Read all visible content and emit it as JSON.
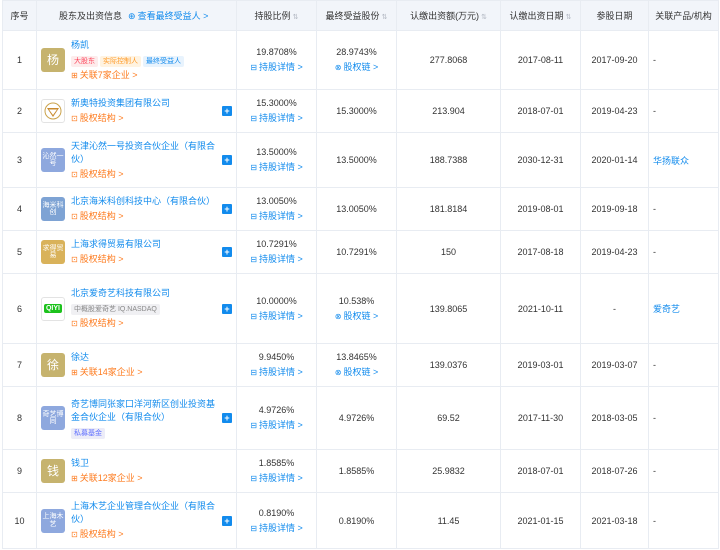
{
  "headers": {
    "seq": "序号",
    "holder": "股东及出资信息",
    "trace_link": "查看最终受益人",
    "trace_arrow": ">",
    "ratio": "持股比例",
    "final_ratio": "最终受益股份",
    "amount": "认缴出资额(万元)",
    "date": "认缴出资日期",
    "join_date": "参股日期",
    "product": "关联产品/机构"
  },
  "link_detail": "持股详情 >",
  "link_chain": "股权链 >",
  "link_structure": "股权结构 >",
  "rows": [
    {
      "seq": "1",
      "logo_text": "杨",
      "logo_color": "#c6b36e",
      "logo_size": "big",
      "name": "杨凯",
      "tags": [
        {
          "text": "大股东",
          "style": "red"
        },
        {
          "text": "实际控制人",
          "style": "orange"
        },
        {
          "text": "最终受益人",
          "style": "blue"
        }
      ],
      "sublink": "关联7家企业 >",
      "sublink_icon": "⊞",
      "plus": false,
      "ratio": "19.8708%",
      "final_ratio": "28.9743%",
      "final_link": true,
      "amount": "277.8068",
      "date": "2017-08-11",
      "join_date": "2017-09-20",
      "product": "-",
      "product_is_link": false
    },
    {
      "seq": "2",
      "logo_text": "",
      "logo_kind": "xinmeite",
      "logo_color": "#ffffff",
      "logo_size": "big",
      "name": "新奥特投资集团有限公司",
      "tags": [],
      "sublink": "股权结构 >",
      "sublink_icon": "⊡",
      "plus": true,
      "ratio": "15.3000%",
      "final_ratio": "15.3000%",
      "final_link": false,
      "amount": "213.904",
      "date": "2018-07-01",
      "join_date": "2019-04-23",
      "product": "-",
      "product_is_link": false
    },
    {
      "seq": "3",
      "logo_text": "沁然一号",
      "logo_color": "#8ea8de",
      "logo_size": "small",
      "name": "天津沁然一号投资合伙企业（有限合伙）",
      "tags": [],
      "sublink": "股权结构 >",
      "sublink_icon": "⊡",
      "plus": true,
      "ratio": "13.5000%",
      "final_ratio": "13.5000%",
      "final_link": false,
      "amount": "188.7388",
      "date": "2030-12-31",
      "join_date": "2020-01-14",
      "product": "华扬联众",
      "product_is_link": true
    },
    {
      "seq": "4",
      "logo_text": "海米科创",
      "logo_color": "#7ea3d4",
      "logo_size": "small",
      "name": "北京海米科创科技中心（有限合伙）",
      "tags": [],
      "sublink": "股权结构 >",
      "sublink_icon": "⊡",
      "plus": true,
      "ratio": "13.0050%",
      "final_ratio": "13.0050%",
      "final_link": false,
      "amount": "181.8184",
      "date": "2019-08-01",
      "join_date": "2019-09-18",
      "product": "-",
      "product_is_link": false
    },
    {
      "seq": "5",
      "logo_text": "求得贸易",
      "logo_color": "#d9b25a",
      "logo_size": "small",
      "name": "上海求得贸易有限公司",
      "tags": [],
      "sublink": "股权结构 >",
      "sublink_icon": "⊡",
      "plus": true,
      "ratio": "10.7291%",
      "final_ratio": "10.7291%",
      "final_link": false,
      "amount": "150",
      "date": "2017-08-18",
      "join_date": "2019-04-23",
      "product": "-",
      "product_is_link": false
    },
    {
      "seq": "6",
      "logo_text": "QIYI",
      "logo_kind": "qiyi",
      "logo_color": "#1cc21c",
      "logo_size": "big",
      "name": "北京爱奇艺科技有限公司",
      "tags": [
        {
          "text": "中概股爱奇艺 IQ.NASDAQ",
          "style": "gray"
        }
      ],
      "sublink": "股权结构 >",
      "sublink_icon": "⊡",
      "plus": true,
      "ratio": "10.0000%",
      "final_ratio": "10.538%",
      "final_link": true,
      "amount": "139.8065",
      "date": "2021-10-11",
      "join_date": "-",
      "product": "爱奇艺",
      "product_is_link": true
    },
    {
      "seq": "7",
      "logo_text": "徐",
      "logo_color": "#c6b36e",
      "logo_size": "big",
      "name": "徐达",
      "tags": [],
      "sublink": "关联14家企业 >",
      "sublink_icon": "⊞",
      "plus": false,
      "ratio": "9.9450%",
      "final_ratio": "13.8465%",
      "final_link": true,
      "amount": "139.0376",
      "date": "2019-03-01",
      "join_date": "2019-03-07",
      "product": "-",
      "product_is_link": false
    },
    {
      "seq": "8",
      "logo_text": "奇艺博同",
      "logo_color": "#8ea8de",
      "logo_size": "small",
      "name": "奇艺博同张家口洋河新区创业投资基金合伙企业（有限合伙）",
      "tags": [
        {
          "text": "私募基金",
          "style": "purple"
        }
      ],
      "sublink": "",
      "sublink_icon": "",
      "plus": true,
      "ratio": "4.9726%",
      "final_ratio": "4.9726%",
      "final_link": false,
      "amount": "69.52",
      "date": "2017-11-30",
      "join_date": "2018-03-05",
      "product": "-",
      "product_is_link": false
    },
    {
      "seq": "9",
      "logo_text": "钱",
      "logo_color": "#c6b36e",
      "logo_size": "big",
      "name": "钱卫",
      "tags": [],
      "sublink": "关联12家企业 >",
      "sublink_icon": "⊞",
      "plus": false,
      "ratio": "1.8585%",
      "final_ratio": "1.8585%",
      "final_link": false,
      "amount": "25.9832",
      "date": "2018-07-01",
      "join_date": "2018-07-26",
      "product": "-",
      "product_is_link": false
    },
    {
      "seq": "10",
      "logo_text": "上海木艺",
      "logo_color": "#8ea8de",
      "logo_size": "small",
      "name": "上海木艺企业管理合伙企业（有限合伙）",
      "tags": [],
      "sublink": "股权结构 >",
      "sublink_icon": "⊡",
      "plus": true,
      "ratio": "0.8190%",
      "final_ratio": "0.8190%",
      "final_link": false,
      "amount": "11.45",
      "date": "2021-01-15",
      "join_date": "2021-03-18",
      "product": "-",
      "product_is_link": false
    }
  ]
}
